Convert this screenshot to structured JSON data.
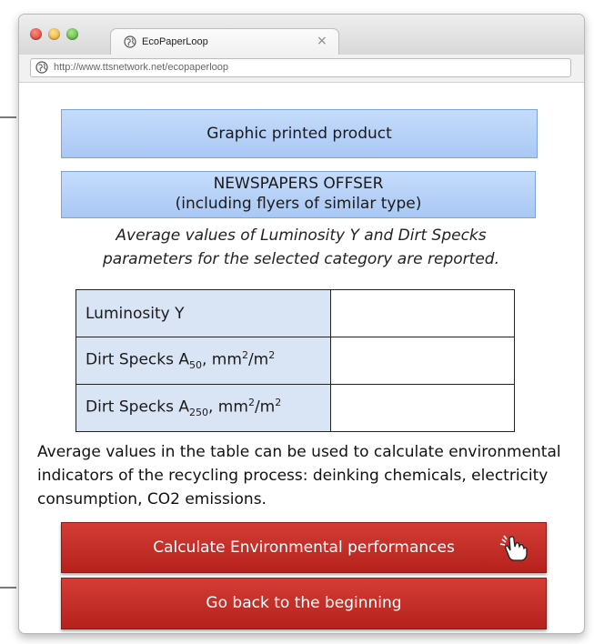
{
  "browser": {
    "tab_title": "EcoPaperLoop",
    "tab_close": "×",
    "url": "http://www.ttsnetwork.net/ecopaperloop"
  },
  "content": {
    "category_box": "Graphic printed product",
    "subcategory_line1": "NEWSPAPERS OFFSER",
    "subcategory_line2": "(including flyers of similar type)",
    "note_line1": "Average values of Luminosity Y and Dirt Specks",
    "note_line2": "parameters for the selected category are reported.",
    "table": {
      "rows": [
        {
          "label": "Luminosity Y",
          "value": ""
        },
        {
          "label_main": "Dirt Specks A",
          "label_sub": "50",
          "label_tail": ", mm",
          "sup1": "2",
          "slash": "/m",
          "sup2": "2",
          "value": ""
        },
        {
          "label_main": "Dirt Specks A",
          "label_sub": "250",
          "label_tail": ", mm",
          "sup1": "2",
          "slash": "/m",
          "sup2": "2",
          "value": ""
        }
      ]
    },
    "paragraph": "Average values in the table can be used to calculate environmental indicators of the recycling process: deinking chemicals, electricity consumption, CO2 emissions.",
    "buttons": {
      "calculate": "Calculate Environmental performances",
      "back": "Go back to the beginning"
    }
  },
  "colors": {
    "box_blue": "#b7d1f8",
    "button_red": "#c72e28",
    "table_label_bg": "#d9e4f5"
  },
  "icons": {
    "tab": "globe-icon",
    "url": "globe-icon",
    "cursor": "hand-pointer-icon"
  }
}
